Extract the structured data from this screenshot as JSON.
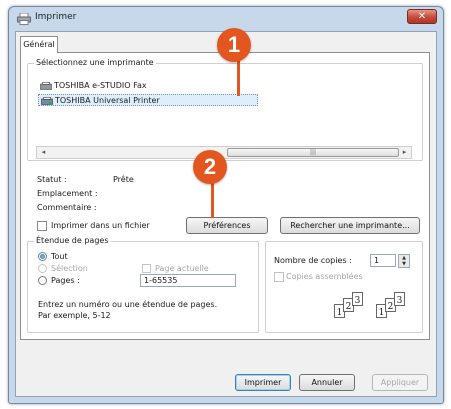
{
  "window": {
    "title": "Imprimer",
    "close_glyph": "✕"
  },
  "tabs": [
    {
      "label": "Général"
    }
  ],
  "printer_select": {
    "label": "Sélectionnez une imprimante",
    "printers": [
      {
        "name": "TOSHIBA e-STUDIO Fax",
        "selected": false
      },
      {
        "name": "TOSHIBA Universal Printer",
        "selected": true
      }
    ]
  },
  "status": {
    "statut_label": "Statut :",
    "statut_value": "Prête",
    "emplacement_label": "Emplacement :",
    "commentaire_label": "Commentaire :"
  },
  "print_to_file": {
    "label": "Imprimer dans un fichier",
    "checked": false
  },
  "buttons": {
    "preferences": "Préférences",
    "find_printer": "Rechercher une imprimante...",
    "print": "Imprimer",
    "cancel": "Annuler",
    "apply": "Appliquer"
  },
  "page_range": {
    "label": "Étendue de pages",
    "options": {
      "all": "Tout",
      "selection": "Sélection",
      "current": "Page actuelle",
      "pages": "Pages :"
    },
    "pages_value": "1-65535",
    "help_line1": "Entrez un numéro ou une étendue de pages.",
    "help_line2": "Par exemple, 5-12"
  },
  "copies": {
    "label": "Nombre de copies :",
    "value": "1",
    "collate_label": "Copies assemblées"
  },
  "callouts": [
    {
      "number": "1"
    },
    {
      "number": "2"
    }
  ],
  "colors": {
    "callout": "#e4561f",
    "selected_row": "#dfeefb",
    "window_frame": "#c6d8ea"
  }
}
